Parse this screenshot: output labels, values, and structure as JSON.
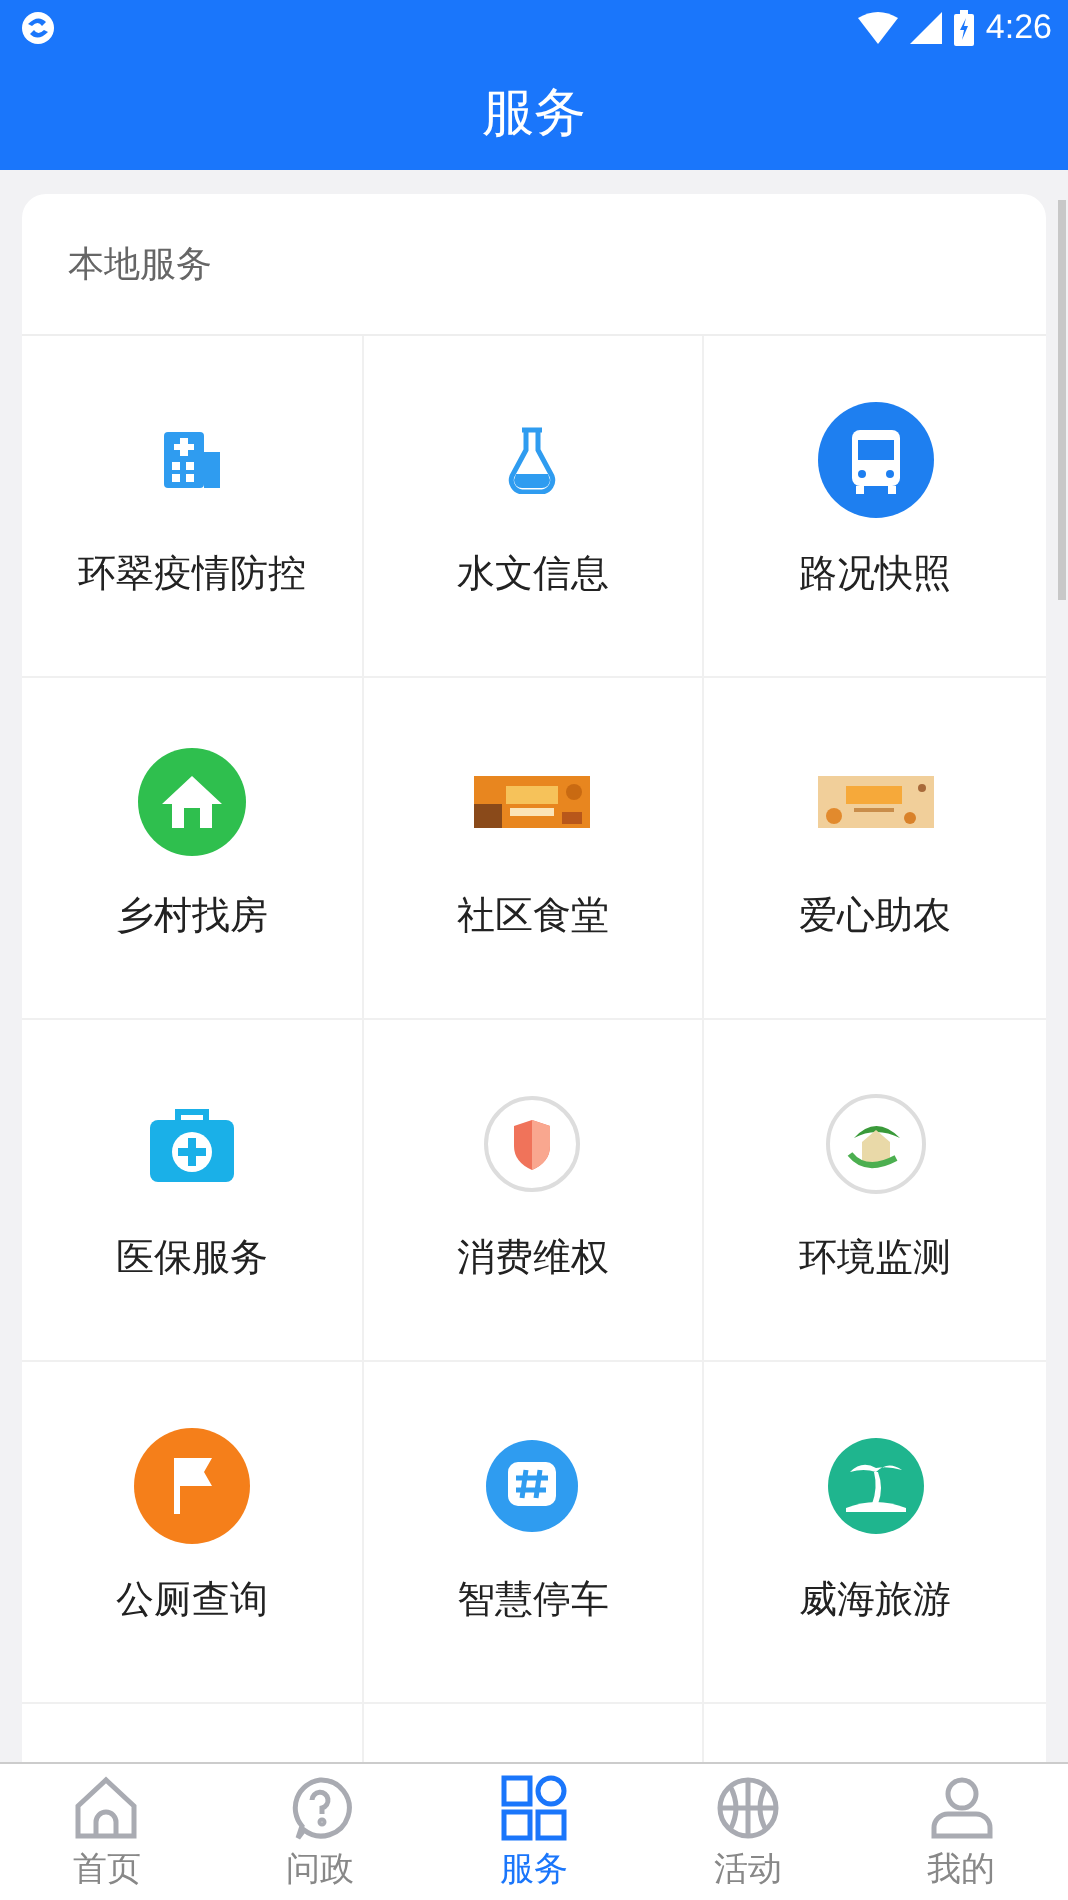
{
  "status_bar": {
    "time": "4:26"
  },
  "header": {
    "title": "服务"
  },
  "section": {
    "title": "本地服务",
    "items": [
      {
        "label": "环翠疫情防控",
        "kind": "icon"
      },
      {
        "label": "水文信息",
        "kind": "icon"
      },
      {
        "label": "路况快照",
        "kind": "icon"
      },
      {
        "label": "乡村找房",
        "kind": "icon"
      },
      {
        "label": "社区食堂",
        "kind": "picture"
      },
      {
        "label": "爱心助农",
        "kind": "picture"
      },
      {
        "label": "医保服务",
        "kind": "icon"
      },
      {
        "label": "消费维权",
        "kind": "icon"
      },
      {
        "label": "环境监测",
        "kind": "icon"
      },
      {
        "label": "公厕查询",
        "kind": "icon"
      },
      {
        "label": "智慧停车",
        "kind": "icon"
      },
      {
        "label": "威海旅游",
        "kind": "icon"
      }
    ]
  },
  "tabs": [
    {
      "label": "首页",
      "selected": false
    },
    {
      "label": "问政",
      "selected": false
    },
    {
      "label": "服务",
      "selected": true
    },
    {
      "label": "活动",
      "selected": false
    },
    {
      "label": "我的",
      "selected": false
    }
  ]
}
